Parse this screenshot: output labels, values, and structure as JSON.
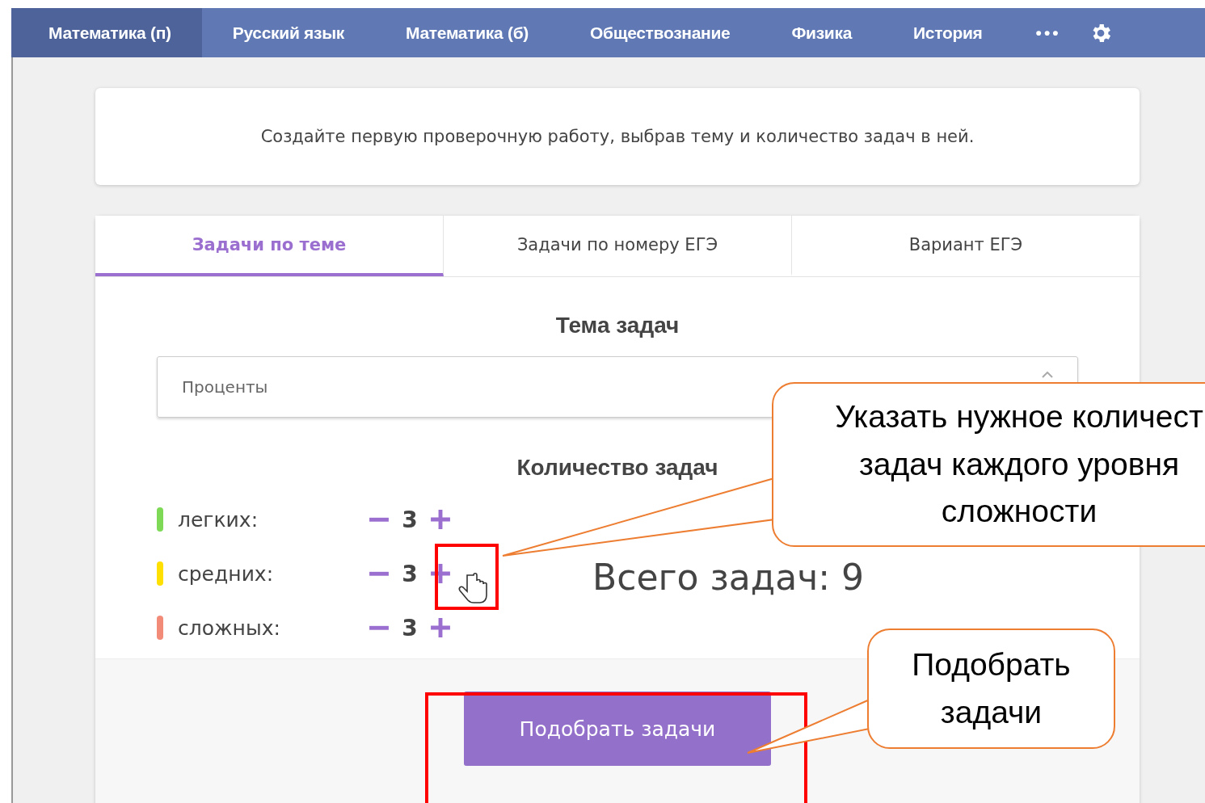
{
  "nav": {
    "items": [
      {
        "label": "Математика (п)",
        "selected": true
      },
      {
        "label": "Русский язык",
        "selected": false
      },
      {
        "label": "Математика (б)",
        "selected": false
      },
      {
        "label": "Обществознание",
        "selected": false
      },
      {
        "label": "Физика",
        "selected": false
      },
      {
        "label": "История",
        "selected": false
      }
    ],
    "more": "•••"
  },
  "info": "Создайте первую проверочную работу, выбрав тему и количество задач в ней.",
  "tabs": [
    {
      "label": "Задачи по теме",
      "selected": true
    },
    {
      "label": "Задачи по номеру ЕГЭ",
      "selected": false
    },
    {
      "label": "Вариант ЕГЭ",
      "selected": false
    }
  ],
  "topic_heading": "Тема задач",
  "topic_select": {
    "value": "Проценты"
  },
  "count_heading": "Количество задач",
  "levels": [
    {
      "label": "легких:",
      "color": "#7ed957",
      "count": "3"
    },
    {
      "label": "средних:",
      "color": "#ffe000",
      "count": "3"
    },
    {
      "label": "сложных:",
      "color": "#f28b78",
      "count": "3"
    }
  ],
  "total": "Всего задач: 9",
  "submit_button": "Подобрать задачи",
  "callouts": [
    {
      "lines": [
        "Указать нужное количест",
        "задач каждого уровня",
        "сложности"
      ]
    },
    {
      "lines": [
        "Подобрать",
        "задачи"
      ]
    }
  ]
}
